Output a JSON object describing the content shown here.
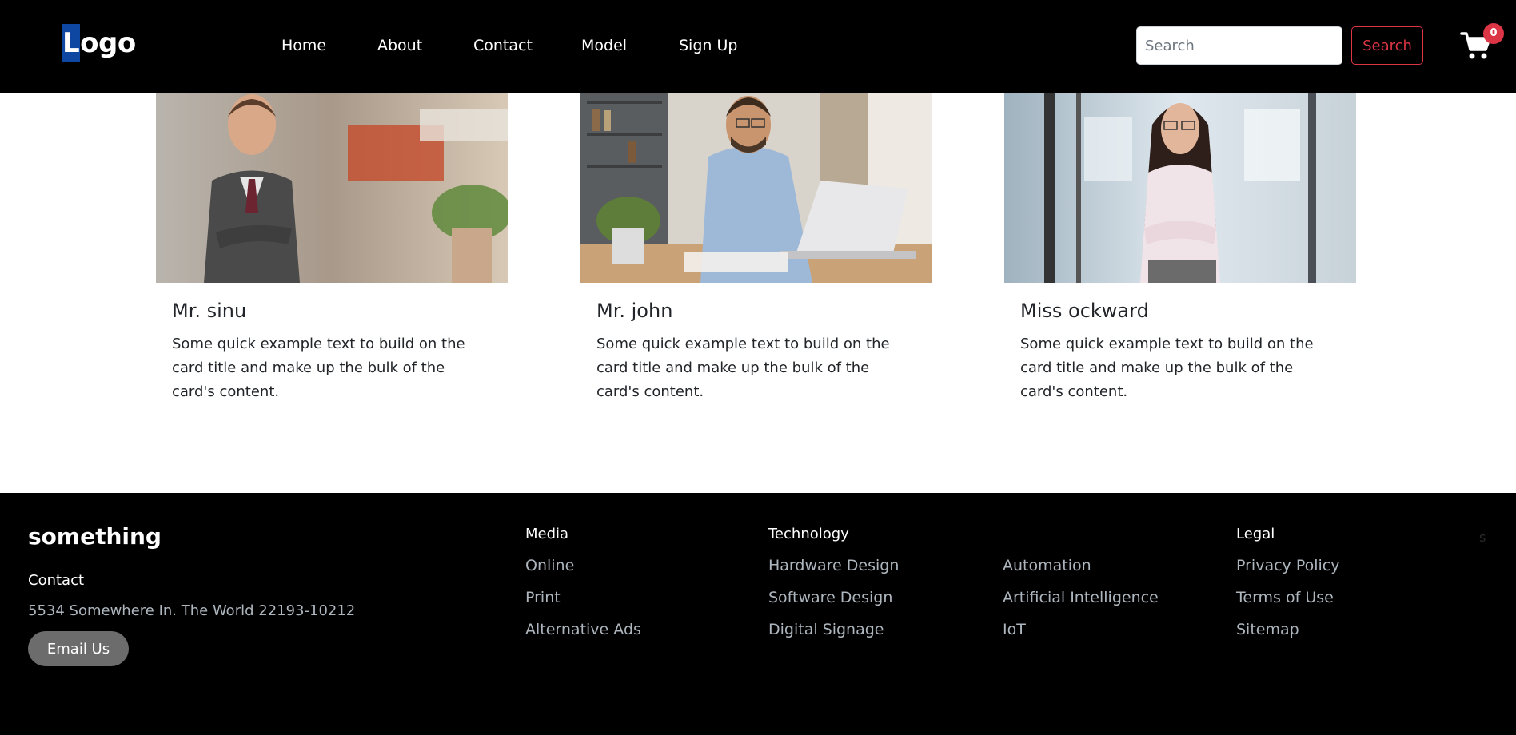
{
  "navbar": {
    "logo_first": "L",
    "logo_rest": "ogo",
    "links": [
      "Home",
      "About",
      "Contact",
      "Model",
      "Sign Up"
    ],
    "search_placeholder": "Search",
    "search_button": "Search",
    "cart_count": "0",
    "cart_icon": "cart-icon"
  },
  "cards": [
    {
      "title": "Mr. sinu",
      "text": "Some quick example text to build on the card title and make up the bulk of the card's content."
    },
    {
      "title": "Mr. john",
      "text": "Some quick example text to build on the card title and make up the bulk of the card's content."
    },
    {
      "title": "Miss ockward",
      "text": "Some quick example text to build on the card title and make up the bulk of the card's content."
    }
  ],
  "footer": {
    "brand": "something",
    "contact_heading": "Contact",
    "address": "5534 Somewhere In. The World 22193-10212",
    "email_button": "Email Us",
    "media": {
      "heading": "Media",
      "links": [
        "Online",
        "Print",
        "Alternative Ads"
      ]
    },
    "technology": {
      "heading": "Technology",
      "links_col1": [
        "Hardware Design",
        "Software Design",
        "Digital Signage"
      ],
      "links_col2": [
        "Automation",
        "Artificial Intelligence",
        "IoT"
      ]
    },
    "legal": {
      "heading": "Legal",
      "links": [
        "Privacy Policy",
        "Terms of Use",
        "Sitemap"
      ]
    },
    "faint_text": "s"
  },
  "colors": {
    "navbar_bg": "#000000",
    "accent_red": "#dc3545",
    "logo_highlight": "#0d47a1",
    "footer_bg": "#000000",
    "footer_link": "#adb5bd"
  }
}
